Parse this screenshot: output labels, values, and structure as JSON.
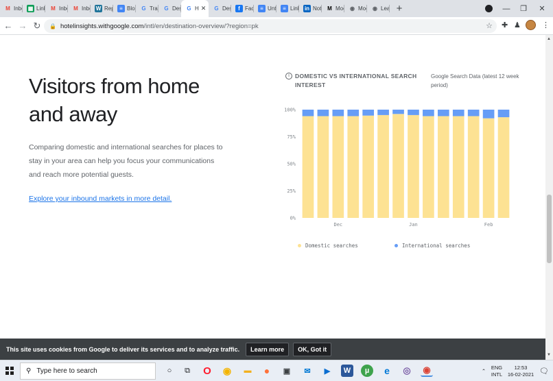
{
  "browser": {
    "tabs": [
      {
        "label": "Inbo",
        "icon": "gmail-icon",
        "color": "#ea4335",
        "glyph": "M"
      },
      {
        "label": "Link",
        "icon": "sheets-icon",
        "color": "#0f9d58",
        "glyph": "▦"
      },
      {
        "label": "Inbo",
        "icon": "gmail-icon",
        "color": "#ea4335",
        "glyph": "M"
      },
      {
        "label": "Inbo",
        "icon": "gmail-icon",
        "color": "#ea4335",
        "glyph": "M"
      },
      {
        "label": "Repo",
        "icon": "wordpress-icon",
        "color": "#21759b",
        "glyph": "W"
      },
      {
        "label": "Blog",
        "icon": "docs-icon",
        "color": "#4285f4",
        "glyph": "≡"
      },
      {
        "label": "Trav",
        "icon": "google-icon",
        "color": "#4285f4",
        "glyph": "G"
      },
      {
        "label": "Dest",
        "icon": "google-icon",
        "color": "#4285f4",
        "glyph": "G"
      },
      {
        "label": "H",
        "icon": "google-icon",
        "color": "#4285f4",
        "glyph": "G",
        "active": true
      },
      {
        "label": "Dest",
        "icon": "google-icon",
        "color": "#4285f4",
        "glyph": "G"
      },
      {
        "label": "Face",
        "icon": "facebook-icon",
        "color": "#1877f2",
        "glyph": "f"
      },
      {
        "label": "Unti",
        "icon": "docs-icon",
        "color": "#4285f4",
        "glyph": "≡"
      },
      {
        "label": "Link",
        "icon": "docs-icon",
        "color": "#4285f4",
        "glyph": "≡"
      },
      {
        "label": "Noti",
        "icon": "linkedin-icon",
        "color": "#0a66c2",
        "glyph": "in"
      },
      {
        "label": "Moc",
        "icon": "medium-icon",
        "color": "#000000",
        "glyph": "M"
      },
      {
        "label": "Moc",
        "icon": "globe-icon",
        "color": "#5f6368",
        "glyph": "◉"
      },
      {
        "label": "Lead",
        "icon": "globe-icon",
        "color": "#5f6368",
        "glyph": "◉"
      }
    ],
    "url_host": "hotelinsights.withgoogle.com",
    "url_path": "/intl/en/destination-overview/?region=pk"
  },
  "hero": {
    "title": "Visitors from home and away",
    "description": "Comparing domestic and international searches for places to stay in your area can help you focus your communications and reach more potential guests.",
    "link": "Explore your inbound markets in more detail."
  },
  "chart_header": {
    "title": "DOMESTIC VS INTERNATIONAL SEARCH INTEREST",
    "subtitle": "Google Search Data (latest 12 week period)"
  },
  "chart_data": {
    "type": "bar",
    "stacked": true,
    "categories": [
      "",
      "",
      "Dec",
      "",
      "",
      "",
      "",
      "Jan",
      "",
      "",
      "",
      "",
      "Feb",
      ""
    ],
    "series": [
      {
        "name": "Domestic searches",
        "color": "#fde293",
        "values": [
          94,
          94,
          94,
          94,
          94.5,
          95,
          96,
          95,
          94,
          94,
          94,
          94,
          92,
          93
        ]
      },
      {
        "name": "International searches",
        "color": "#669df6",
        "values": [
          6,
          6,
          6,
          6,
          5.5,
          5,
          4,
          5,
          6,
          6,
          6,
          6,
          8,
          7
        ]
      }
    ],
    "yticks": [
      "0%",
      "25%",
      "50%",
      "75%",
      "100%"
    ],
    "ylim": [
      0,
      100
    ],
    "grid": false,
    "legend": "bottom"
  },
  "cookie": {
    "text": "This site uses cookies from Google to deliver its services and to analyze traffic.",
    "learn_more": "Learn more",
    "ok": "OK, Got it"
  },
  "taskbar": {
    "search_placeholder": "Type here to search",
    "lang": "ENG",
    "layout": "INTL",
    "time": "12:53",
    "date": "16-02-2021"
  }
}
